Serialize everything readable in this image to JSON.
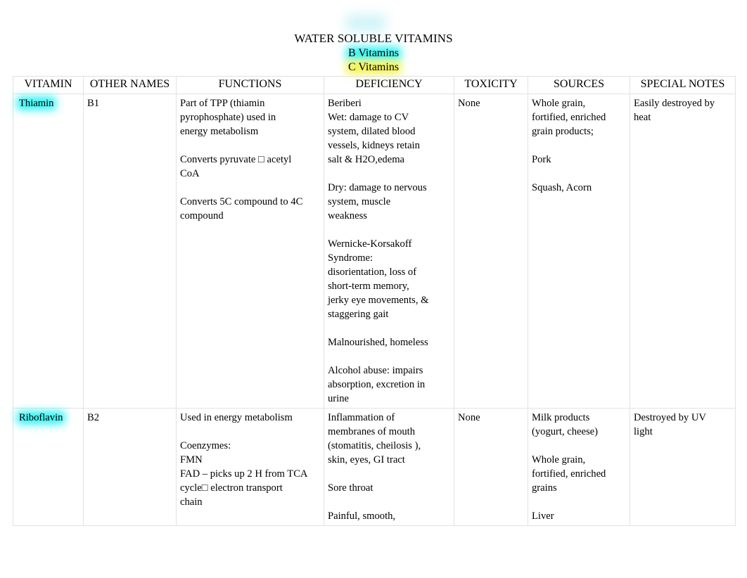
{
  "document": {
    "title": "WATER SOLUBLE VITAMINS",
    "subtitle_b": "B Vitamins",
    "subtitle_c": "C Vitamins",
    "highlight_cyan": "#25f2f2",
    "highlight_yellow": "#f2f24a"
  },
  "table": {
    "headers": [
      "VITAMIN",
      "OTHER NAMES",
      "FUNCTIONS",
      "DEFICIENCY",
      "TOXICITY",
      "SOURCES",
      "SPECIAL NOTES"
    ],
    "rows": [
      {
        "vitamin": "Thiamin",
        "vitamin_highlight": "cyan",
        "other_names": "B1",
        "functions": [
          "Part of TPP (thiamin",
          "pyrophosphate) used in",
          "energy metabolism",
          "",
          "Converts pyruvate □   acetyl",
          "CoA",
          "",
          "Converts 5C compound to 4C",
          "compound"
        ],
        "deficiency": [
          "Beriberi",
          "Wet:  damage to CV",
          "system, dilated blood",
          "vessels, kidneys retain",
          "salt & H2O,edema",
          "",
          "Dry: damage to nervous",
          "system,  muscle",
          "weakness",
          "",
          "Wernicke-Korsakoff",
          "Syndrome:",
          "disorientation, loss of",
          "short-term memory,",
          "jerky eye movements, &",
          "staggering gait",
          "",
          "Malnourished, homeless",
          "",
          "Alcohol abuse: impairs",
          "absorption, excretion in",
          "urine"
        ],
        "toxicity": "None",
        "sources": [
          "Whole grain,",
          "fortified, enriched",
          "grain products;",
          "",
          "Pork",
          "",
          "Squash, Acorn"
        ],
        "special_notes": [
          "Easily destroyed by",
          "heat"
        ]
      },
      {
        "vitamin": "Riboflavin",
        "vitamin_highlight": "cyan",
        "other_names": "B2",
        "functions": [
          "Used in energy metabolism",
          "",
          "Coenzymes:",
          "FMN",
          "FAD – picks up 2 H from TCA",
          "cycle□   electron transport",
          "chain"
        ],
        "deficiency": [
          "Inflammation of",
          "membranes of mouth",
          "(stomatitis, cheilosis ),",
          "skin, eyes, GI tract",
          "",
          "Sore throat",
          "",
          "Painful, smooth,"
        ],
        "toxicity": "None",
        "sources": [
          "Milk products",
          "(yogurt, cheese)",
          "",
          "Whole grain,",
          "fortified, enriched",
          "grains",
          "",
          "Liver"
        ],
        "special_notes": [
          "Destroyed by UV",
          "light"
        ]
      }
    ]
  }
}
